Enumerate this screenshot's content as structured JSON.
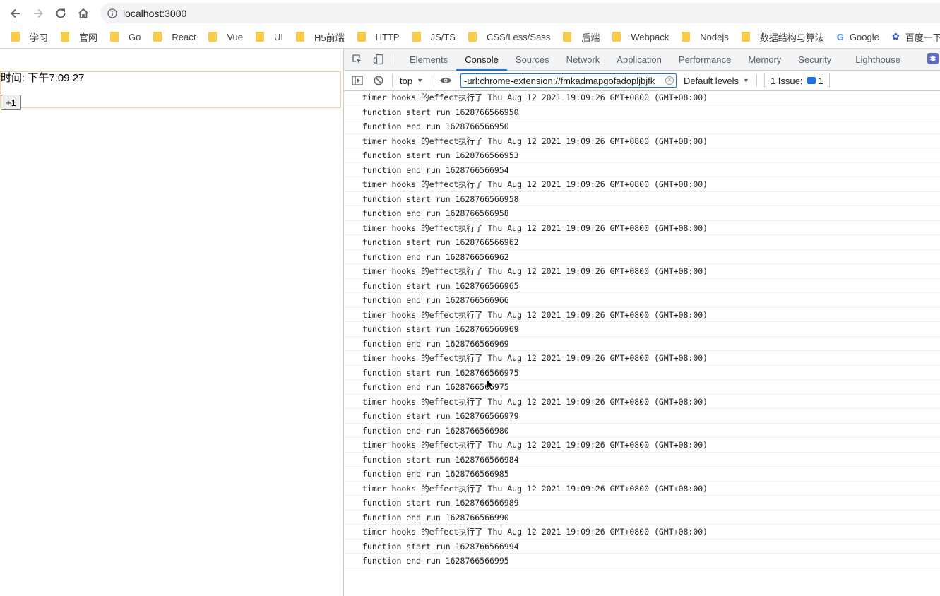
{
  "browser": {
    "url": "localhost:3000",
    "bookmarks": [
      "学习",
      "官网",
      "Go",
      "React",
      "Vue",
      "UI",
      "H5前端",
      "HTTP",
      "JS/TS",
      "CSS/Less/Sass",
      "后端",
      "Webpack",
      "Nodejs",
      "数据结构与算法"
    ],
    "bookmark_google": "Google",
    "bookmark_baidu": "百度一下，你就知道"
  },
  "page": {
    "time_text": "时间: 下午7:09:27",
    "plus_button": "+1"
  },
  "devtools": {
    "tabs": [
      "Elements",
      "Console",
      "Sources",
      "Network",
      "Application",
      "Performance",
      "Memory",
      "Security",
      "Lighthouse"
    ],
    "active_tab": "Console",
    "context": "top",
    "filter_value": "-url:chrome-extension://fmkadmapgofadopljbjfk",
    "levels": "Default levels",
    "issues_label": "1 Issue:",
    "issues_count": "1"
  },
  "console": {
    "messages": [
      "timer hooks 的effect执行了 Thu Aug 12 2021 19:09:26 GMT+0800 (GMT+08:00)",
      "function start run 1628766566950",
      "function end run 1628766566950",
      "timer hooks 的effect执行了 Thu Aug 12 2021 19:09:26 GMT+0800 (GMT+08:00)",
      "function start run 1628766566953",
      "function end run 1628766566954",
      "timer hooks 的effect执行了 Thu Aug 12 2021 19:09:26 GMT+0800 (GMT+08:00)",
      "function start run 1628766566958",
      "function end run 1628766566958",
      "timer hooks 的effect执行了 Thu Aug 12 2021 19:09:26 GMT+0800 (GMT+08:00)",
      "function start run 1628766566962",
      "function end run 1628766566962",
      "timer hooks 的effect执行了 Thu Aug 12 2021 19:09:26 GMT+0800 (GMT+08:00)",
      "function start run 1628766566965",
      "function end run 1628766566966",
      "timer hooks 的effect执行了 Thu Aug 12 2021 19:09:26 GMT+0800 (GMT+08:00)",
      "function start run 1628766566969",
      "function end run 1628766566969",
      "timer hooks 的effect执行了 Thu Aug 12 2021 19:09:26 GMT+0800 (GMT+08:00)",
      "function start run 1628766566975",
      "function end run 1628766566975",
      "timer hooks 的effect执行了 Thu Aug 12 2021 19:09:26 GMT+0800 (GMT+08:00)",
      "function start run 1628766566979",
      "function end run 1628766566980",
      "timer hooks 的effect执行了 Thu Aug 12 2021 19:09:26 GMT+0800 (GMT+08:00)",
      "function start run 1628766566984",
      "function end run 1628766566985",
      "timer hooks 的effect执行了 Thu Aug 12 2021 19:09:26 GMT+0800 (GMT+08:00)",
      "function start run 1628766566989",
      "function end run 1628766566990",
      "timer hooks 的effect执行了 Thu Aug 12 2021 19:09:26 GMT+0800 (GMT+08:00)",
      "function start run 1628766566994",
      "function end run 1628766566995"
    ]
  }
}
